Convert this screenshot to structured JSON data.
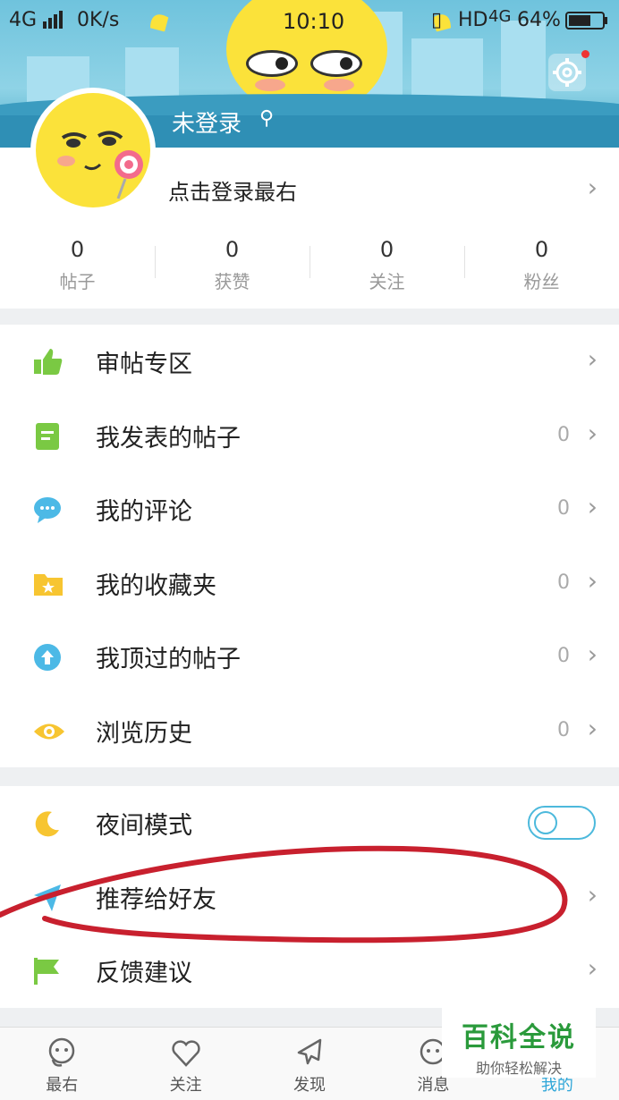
{
  "status_bar": {
    "network": "4G",
    "speed": "0K/s",
    "time": "10:10",
    "hd": "HD",
    "net2": "4G",
    "battery": "64%"
  },
  "profile": {
    "username": "未登录",
    "gender_icon": "male-icon",
    "login_hint": "点击登录最右",
    "stats": [
      {
        "value": "0",
        "label": "帖子"
      },
      {
        "value": "0",
        "label": "获赞"
      },
      {
        "value": "0",
        "label": "关注"
      },
      {
        "value": "0",
        "label": "粉丝"
      }
    ]
  },
  "menu": {
    "items": [
      {
        "label": "审帖专区",
        "icon": "thumbs-up-icon",
        "count": ""
      },
      {
        "label": "我发表的帖子",
        "icon": "document-icon",
        "count": "0"
      },
      {
        "label": "我的评论",
        "icon": "comment-icon",
        "count": "0"
      },
      {
        "label": "我的收藏夹",
        "icon": "folder-star-icon",
        "count": "0"
      },
      {
        "label": "我顶过的帖子",
        "icon": "upvote-icon",
        "count": "0"
      },
      {
        "label": "浏览历史",
        "icon": "eye-icon",
        "count": "0"
      }
    ]
  },
  "settings": {
    "night_mode": "夜间模式",
    "night_mode_on": false,
    "recommend": "推荐给好友",
    "feedback": "反馈建议"
  },
  "tabs": [
    {
      "label": "最右",
      "icon": "home-face-icon"
    },
    {
      "label": "关注",
      "icon": "heart-icon"
    },
    {
      "label": "发现",
      "icon": "plane-icon"
    },
    {
      "label": "消息",
      "icon": "message-icon"
    },
    {
      "label": "我的",
      "icon": "profile-icon"
    }
  ],
  "watermark": {
    "title": "百科全说",
    "subtitle": "助你轻松解决"
  },
  "colors": {
    "accent": "#2fa6d8",
    "annotation": "#c8202e",
    "header": "#6fc3dd"
  }
}
